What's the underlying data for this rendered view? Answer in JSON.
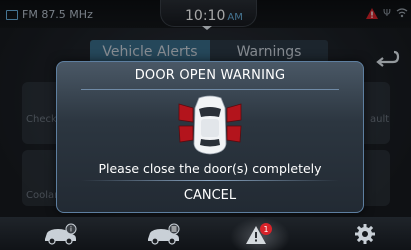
{
  "status_bar": {
    "radio": "FM 87.5 MHz",
    "time": "10:10",
    "ampm": "AM"
  },
  "background": {
    "tabs": [
      "Vehicle Alerts",
      "Warnings"
    ],
    "left_label": "Check",
    "right_label": "ault",
    "left_label2": "Coolant"
  },
  "modal": {
    "title": "DOOR OPEN WARNING",
    "message": "Please close the door(s) completely",
    "cancel": "CANCEL"
  },
  "bottom_nav": {
    "items": [
      {
        "icon": "car-info-icon",
        "badge": "i"
      },
      {
        "icon": "car-service-icon",
        "badge": "≡"
      },
      {
        "icon": "warning-icon",
        "badge": "1"
      },
      {
        "icon": "gear-icon",
        "badge": ""
      }
    ]
  },
  "colors": {
    "accent": "#6ab2e0",
    "warning_red": "#d8232a",
    "door_red": "#b3141c"
  }
}
